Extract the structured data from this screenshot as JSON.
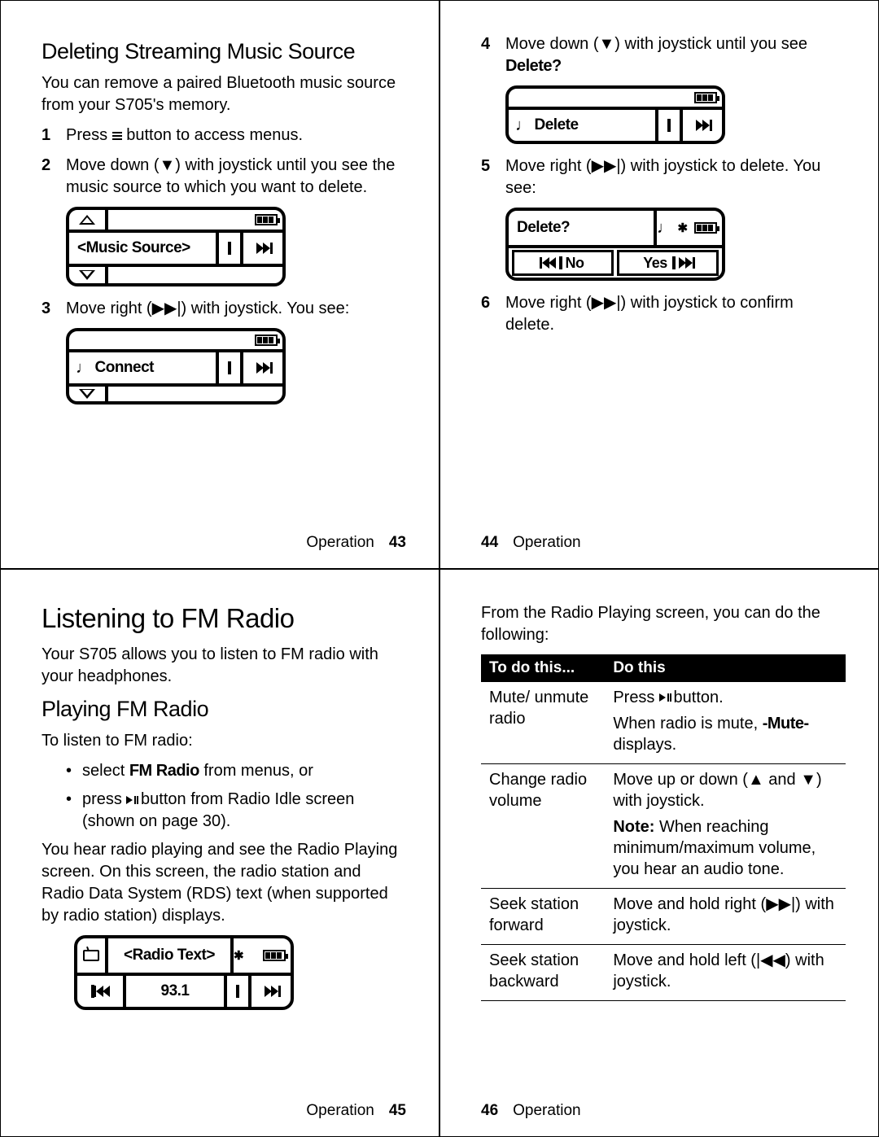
{
  "p43": {
    "heading": "Deleting Streaming Music Source",
    "intro": "You can remove a paired Bluetooth music source from your S705's memory.",
    "step1_a": "Press ",
    "step1_b": " button to access menus.",
    "step2": "Move down (▼) with joystick until you see the music source to which you want to delete.",
    "lcd1_text": "<Music Source>",
    "step3": "Move right (▶▶|) with joystick. You see:",
    "lcd2_text": "Connect",
    "footer_label": "Operation",
    "footer_num": "43"
  },
  "p44": {
    "step4_a": "Move down (▼) with joystick until you see ",
    "step4_bold": "Delete?",
    "lcd1_text": "Delete",
    "step5": "Move right (▶▶|) with joystick to delete. You see:",
    "lcd2_title": "Delete?",
    "lcd2_no": "No",
    "lcd2_yes": "Yes",
    "step6": "Move right (▶▶|) with joystick to confirm delete.",
    "footer_label": "Operation",
    "footer_num": "44"
  },
  "p45": {
    "h1": "Listening to FM Radio",
    "intro": "Your S705 allows you to listen to FM radio with your headphones.",
    "h2": "Playing FM Radio",
    "lead": "To listen to FM radio:",
    "bullet1_a": "select ",
    "bullet1_bold": "FM Radio",
    "bullet1_b": " from menus, or",
    "bullet2_a": "press ",
    "bullet2_b": " button from Radio Idle screen (shown on page 30).",
    "para": "You hear radio playing and see the Radio Playing screen. On this screen, the radio station and Radio Data System (RDS) text (when supported by radio station) displays.",
    "lcd_top": "<Radio Text>",
    "lcd_freq": "93.1",
    "footer_label": "Operation",
    "footer_num": "45"
  },
  "p46": {
    "intro": "From the Radio Playing screen, you can do the following:",
    "th1": "To do this...",
    "th2": "Do this",
    "r1c1": "Mute/ unmute radio",
    "r1c2_a": "Press ",
    "r1c2_b": " button.",
    "r1c2_c": "When radio is mute, ",
    "r1c2_bold": "-Mute-",
    "r1c2_d": " displays.",
    "r2c1": "Change radio volume",
    "r2c2_a": "Move up or down (▲ and ▼) with joystick.",
    "r2c2_note_label": "Note:",
    "r2c2_note": " When reaching minimum/maximum volume, you hear an audio tone.",
    "r3c1": "Seek station forward",
    "r3c2": "Move and hold right (▶▶|) with joystick.",
    "r4c1": "Seek station backward",
    "r4c2": "Move and hold left (|◀◀) with joystick.",
    "footer_label": "Operation",
    "footer_num": "46"
  }
}
